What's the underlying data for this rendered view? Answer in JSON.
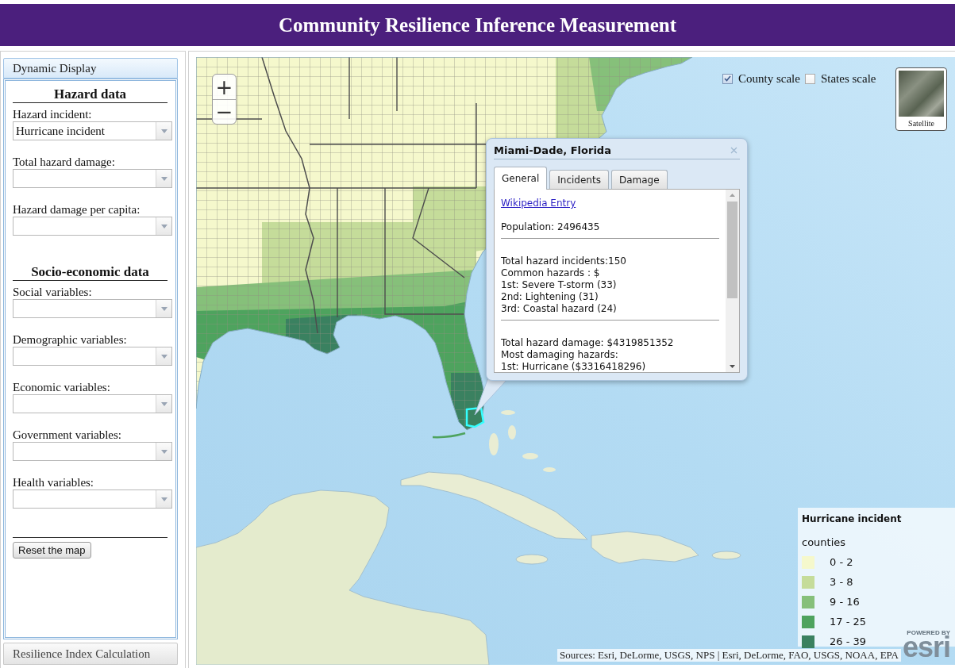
{
  "header": {
    "title": "Community Resilience Inference Measurement"
  },
  "sidebar": {
    "sections": [
      {
        "label": "Dynamic Display",
        "expanded": true,
        "groups": [
          {
            "heading": "Hazard data",
            "fields": [
              {
                "label": "Hazard incident:",
                "value": "Hurricane incident"
              },
              {
                "label": "Total hazard damage:"
              },
              {
                "label": "Hazard damage per capita:"
              }
            ]
          },
          {
            "heading": "Socio-economic data",
            "fields": [
              {
                "label": "Social variables:"
              },
              {
                "label": "Demographic variables:"
              },
              {
                "label": "Economic variables:"
              },
              {
                "label": "Government variables:"
              },
              {
                "label": "Health variables:"
              }
            ]
          }
        ],
        "button": "Reset the map"
      },
      {
        "label": "Resilience Index Calculation",
        "expanded": false
      }
    ]
  },
  "map": {
    "zoom_controls": [
      {
        "label": "+"
      },
      {
        "label": "−"
      }
    ],
    "scale_options": [
      {
        "label": "County scale",
        "checked": true
      },
      {
        "label": "States scale",
        "checked": false
      }
    ],
    "basemap_button": {
      "label": "Satellite"
    },
    "popup": {
      "title": "Miami-Dade, Florida",
      "tabs": [
        {
          "label": "General",
          "selected": true
        },
        {
          "label": "Incidents",
          "selected": false
        },
        {
          "label": "Damage",
          "selected": false
        }
      ],
      "link": "Wikipedia Entry",
      "sections": [
        {
          "lines": [
            "Population: 2496435"
          ]
        },
        {
          "lines": [
            "Total hazard incidents:150",
            "Common hazards : $",
            "1st: Severe T-storm (33)",
            "2nd: Lightening (31)",
            "3rd: Coastal hazard (24)"
          ]
        },
        {
          "lines": [
            "Total hazard damage: $4319851352",
            "Most damaging hazards:",
            "1st: Hurricane ($3316418296)"
          ]
        }
      ]
    },
    "legend": {
      "title": "Hurricane incident",
      "subtitle": "counties",
      "classes": [
        {
          "label": "0 - 2",
          "color": "#f5f8cc"
        },
        {
          "label": "3 - 8",
          "color": "#c5dc9a"
        },
        {
          "label": "9 - 16",
          "color": "#86c07a"
        },
        {
          "label": "17 - 25",
          "color": "#4ea35e"
        },
        {
          "label": "26 - 39",
          "color": "#3a8160"
        }
      ]
    },
    "attribution": "Sources: Esri, DeLorme, USGS, NPS | Esri, DeLorme, FAO, USGS, NOAA, EPA",
    "logo": {
      "tagline": "POWERED BY",
      "name": "esri"
    }
  }
}
